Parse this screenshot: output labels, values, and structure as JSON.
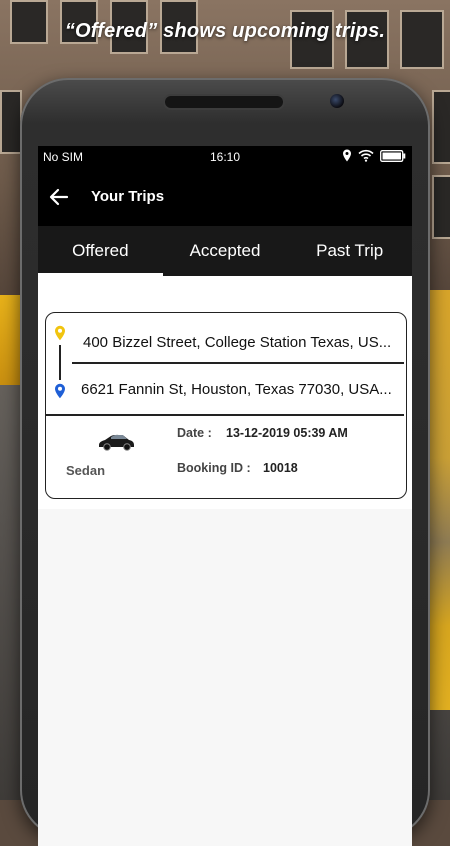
{
  "caption": "“Offered” shows upcoming trips.",
  "status_bar": {
    "carrier": "No SIM",
    "time": "16:10"
  },
  "app_bar": {
    "title": "Your Trips"
  },
  "tabs": [
    {
      "label": "Offered",
      "active": true
    },
    {
      "label": "Accepted",
      "active": false
    },
    {
      "label": "Past Trip",
      "active": false
    }
  ],
  "trip": {
    "pickup": "400 Bizzel Street, College Station Texas, US...",
    "dropoff": "6621 Fannin St, Houston, Texas 77030, USA...",
    "vehicle": "Sedan",
    "date_label": "Date :",
    "date_value": "13-12-2019 05:39 AM",
    "booking_label": "Booking ID :",
    "booking_value": "10018"
  },
  "colors": {
    "pickup_pin": "#f1c40f",
    "dropoff_pin": "#1f5fd6",
    "appbar": "#000000",
    "tabbar": "#181818"
  },
  "icons": [
    "back-arrow-icon",
    "location-icon",
    "wifi-icon",
    "battery-icon",
    "pickup-pin-icon",
    "dropoff-pin-icon",
    "sedan-car-icon"
  ]
}
